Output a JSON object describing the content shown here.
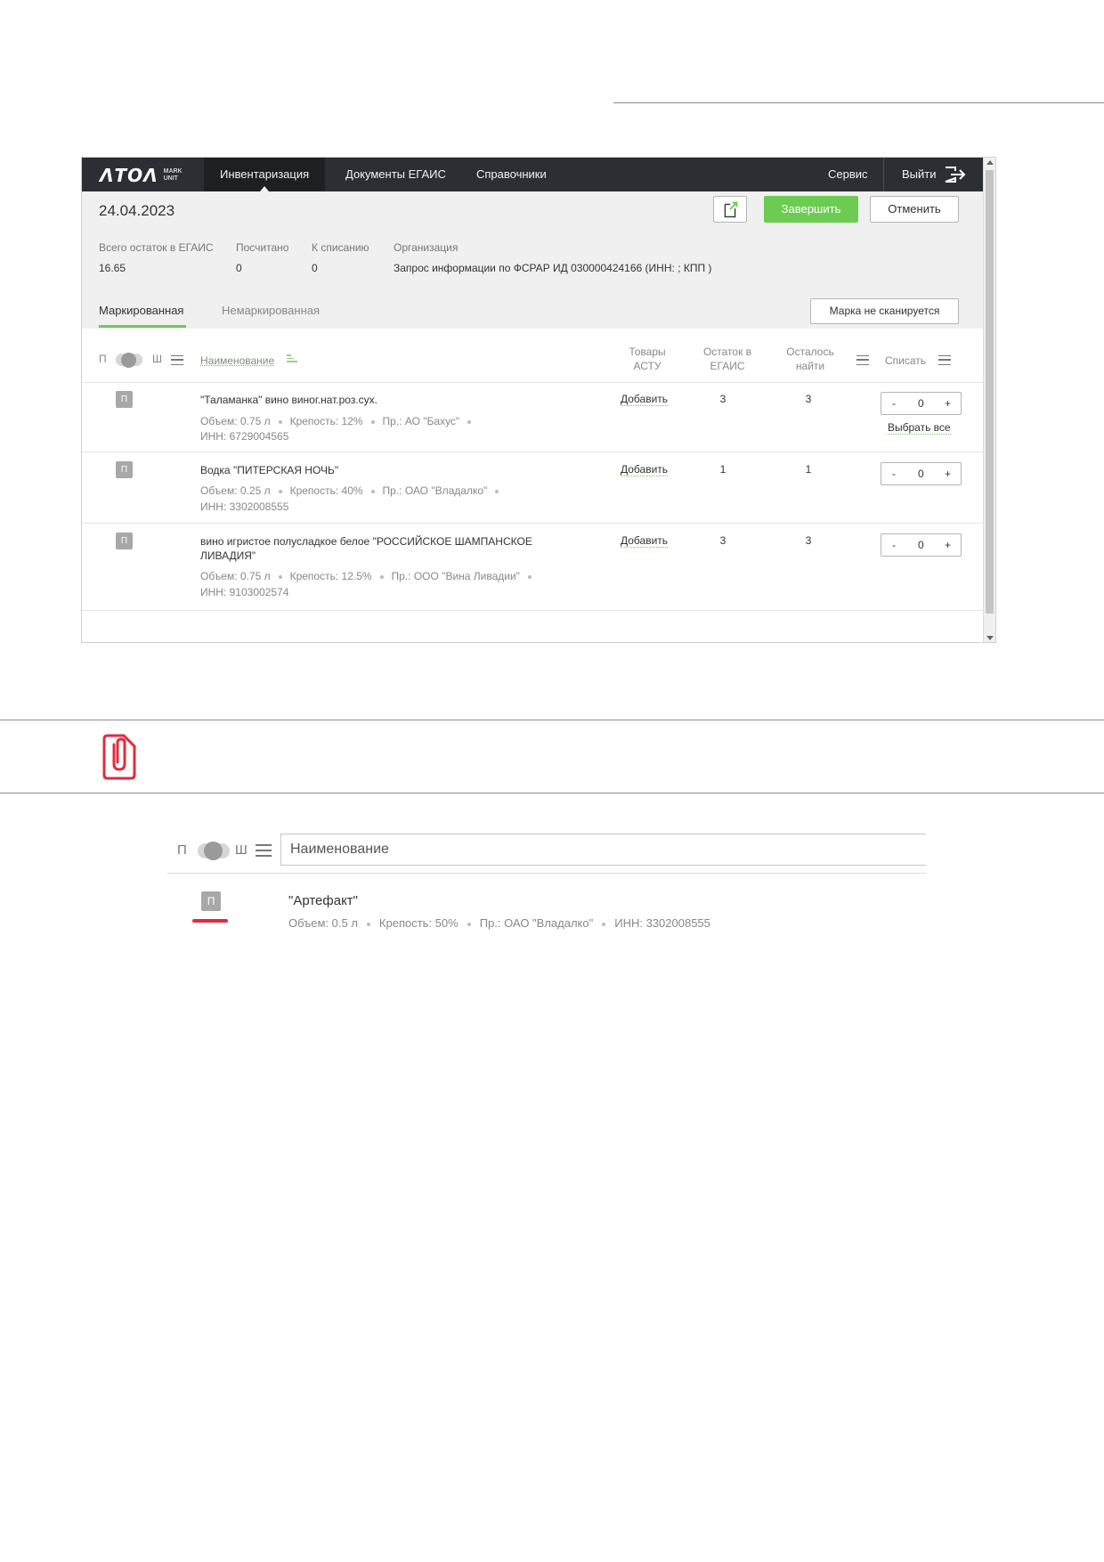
{
  "app": {
    "logo": {
      "word": "ΛTOΛ",
      "sub1": "MARK",
      "sub2": "UNIT"
    },
    "nav": [
      {
        "label": "Инвентаризация"
      },
      {
        "label": "Документы ЕГАИС"
      },
      {
        "label": "Справочники"
      },
      {
        "label": "Сервис"
      },
      {
        "label": "Выйти"
      }
    ],
    "date": "24.04.2023",
    "buttons": {
      "finish": "Завершить",
      "cancel": "Отменить",
      "mark_not_scanned": "Марка не сканируется"
    },
    "stats": [
      {
        "label": "Всего остаток в ЕГАИС",
        "value": "16.65"
      },
      {
        "label": "Посчитано",
        "value": "0"
      },
      {
        "label": "К списанию",
        "value": "0"
      },
      {
        "label": "Организация",
        "value": "Запрос информации по ФСРАР ИД 030000424166 (ИНН: ; КПП )"
      }
    ],
    "tabs": [
      {
        "label": "Маркированная"
      },
      {
        "label": "Немаркированная"
      }
    ],
    "columns": {
      "toggle_left": "П",
      "toggle_right": "Ш",
      "name": "Наименование",
      "goods_line1": "Товары",
      "goods_line2": "АСТУ",
      "rest_line1": "Остаток в",
      "rest_line2": "ЕГАИС",
      "left_line1": "Осталось",
      "left_line2": "найти",
      "writeoff": "Списать"
    },
    "rows": [
      {
        "badge": "П",
        "name": "\"Таламанка\" вино виног.нат.роз.сух.",
        "volume": "Объем: 0.75 л",
        "strength": "Крепость: 12%",
        "producer": "Пр.: АО \"Бахус\"",
        "inn": "ИНН: 6729004565",
        "add": "Добавить",
        "rest": "3",
        "left": "3",
        "qty": "0",
        "select_all": "Выбрать все"
      },
      {
        "badge": "П",
        "name": "Водка \"ПИТЕРСКАЯ НОЧЬ\"",
        "volume": "Объем: 0.25 л",
        "strength": "Крепость: 40%",
        "producer": "Пр.: ОАО \"Владалко\"",
        "inn": "ИНН: 3302008555",
        "add": "Добавить",
        "rest": "1",
        "left": "1",
        "qty": "0"
      },
      {
        "badge": "П",
        "name": "вино игристое полусладкое белое \"РОССИЙСКОЕ ШАМПАНСКОЕ ЛИВАДИЯ\"",
        "volume": "Объем: 0.75 л",
        "strength": "Крепость: 12.5%",
        "producer": "Пр.: ООО \"Вина Ливадии\"",
        "inn": "ИНН: 9103002574",
        "add": "Добавить",
        "rest": "3",
        "left": "3",
        "qty": "0"
      }
    ],
    "stepper": {
      "minus": "-",
      "plus": "+"
    }
  },
  "fragment": {
    "toggle_left": "П",
    "toggle_right": "Ш",
    "search_placeholder": "Наименование",
    "item": {
      "badge": "П",
      "name": "\"Артефакт\"",
      "volume": "Объем: 0.5 л",
      "strength": "Крепость: 50%",
      "producer": "Пр.: ОАО \"Владалко\"",
      "inn": "ИНН: 3302008555"
    }
  },
  "colors": {
    "accent_green": "#6ccc52",
    "topbar": "#2b2f33",
    "note_red": "#e02c3c"
  },
  "icons": [
    "export-icon",
    "exit-icon",
    "menu-icon",
    "sort-icon",
    "paperclip-document-icon"
  ]
}
